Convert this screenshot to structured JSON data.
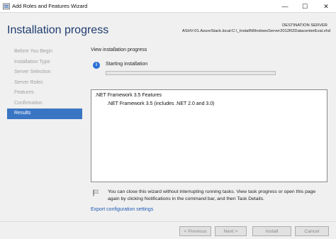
{
  "window": {
    "title": "Add Roles and Features Wizard",
    "minimize_glyph": "—",
    "maximize_glyph": "☐",
    "close_glyph": "✕"
  },
  "header": {
    "page_title": "Installation progress",
    "destination_label": "DESTINATION SERVER",
    "destination_value": "ASHV-01.AzureStack.local:C:\\_Install\\WindowsServer2012R2DatacenterEval.vhd"
  },
  "nav": {
    "items": [
      {
        "label": "Before You Begin",
        "active": false
      },
      {
        "label": "Installation Type",
        "active": false
      },
      {
        "label": "Server Selection",
        "active": false
      },
      {
        "label": "Server Roles",
        "active": false
      },
      {
        "label": "Features",
        "active": false
      },
      {
        "label": "Confirmation",
        "active": false
      },
      {
        "label": "Results",
        "active": true
      }
    ]
  },
  "main": {
    "view_label": "View installation progress",
    "info_icon": "info-icon",
    "status": "Starting installation",
    "progress_fraction": 0.0,
    "features": {
      "parent": ".NET Framework 3.5 Features",
      "child": ".NET Framework 3.5 (includes .NET 2.0 and 3.0)"
    },
    "notice_icon": "flag-icon",
    "notice": "You can close this wizard without interrupting running tasks. View task progress or open this page again by clicking Notifications in the command bar, and then Task Details.",
    "export_link": "Export configuration settings"
  },
  "footer": {
    "previous": "< Previous",
    "next": "Next >",
    "install": "Install",
    "cancel": "Cancel"
  },
  "colors": {
    "accent": "#3a75c4",
    "title_blue": "#1e3c6e",
    "link": "#1f5cb5",
    "progress": "#06b025"
  }
}
